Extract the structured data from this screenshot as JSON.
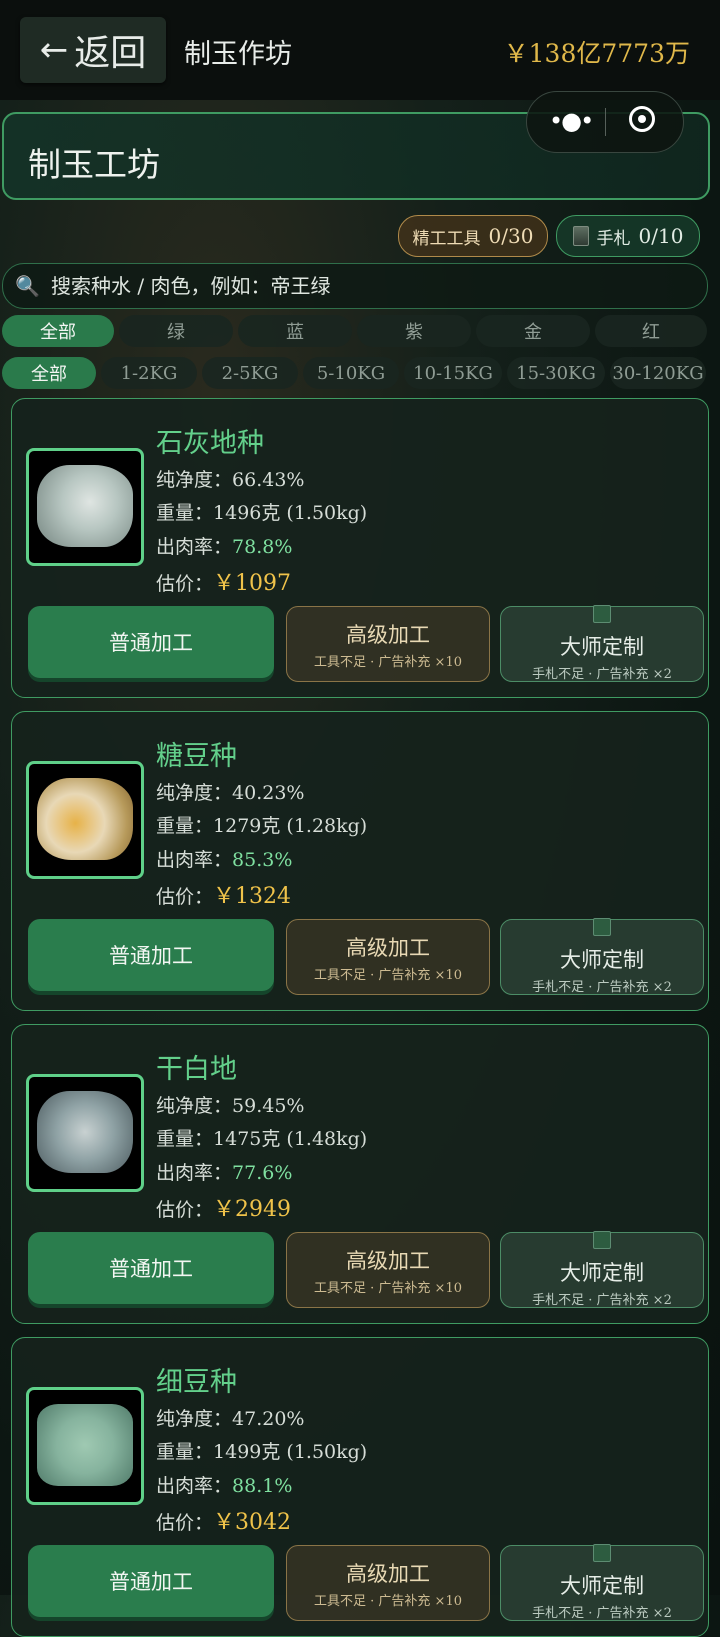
{
  "topbar": {
    "back_arrow": "←",
    "back_label": "返回",
    "title": "制玉作坊",
    "money": "￥138亿7773万"
  },
  "header": {
    "title": "制玉工坊"
  },
  "capsule": {
    "more_icon": "more-dots-icon",
    "close_icon": "target-icon"
  },
  "badges": {
    "tools_label": "精工工具",
    "tools_count": "0/30",
    "slips_label": "手札",
    "slips_count": "0/10"
  },
  "search": {
    "placeholder": "搜索种水 / 肉色，例如：帝王绿",
    "icon": "search-icon"
  },
  "color_filters": [
    "全部",
    "绿",
    "蓝",
    "紫",
    "金",
    "红"
  ],
  "weight_filters": [
    "全部",
    "1-2KG",
    "2-5KG",
    "5-10KG",
    "10-15KG",
    "15-30KG",
    "30-120KG"
  ],
  "labels": {
    "purity": "纯净度：",
    "weight": "重量：",
    "yield": "出肉率：",
    "price": "估价："
  },
  "buttons": {
    "normal": "普通加工",
    "advanced": "高级加工",
    "advanced_note": "工具不足 · 广告补充 ×10",
    "master": "大师定制",
    "master_note": "手札不足 · 广告补充 ×2"
  },
  "items": [
    {
      "name": "石灰地种",
      "purity": "66.43%",
      "weight": "1496克 (1.50kg)",
      "yield": "78.8%",
      "price": "￥1097"
    },
    {
      "name": "糖豆种",
      "purity": "40.23%",
      "weight": "1279克 (1.28kg)",
      "yield": "85.3%",
      "price": "￥1324"
    },
    {
      "name": "干白地",
      "purity": "59.45%",
      "weight": "1475克 (1.48kg)",
      "yield": "77.6%",
      "price": "￥2949"
    },
    {
      "name": "细豆种",
      "purity": "47.20%",
      "weight": "1499克 (1.50kg)",
      "yield": "88.1%",
      "price": "￥3042"
    }
  ]
}
